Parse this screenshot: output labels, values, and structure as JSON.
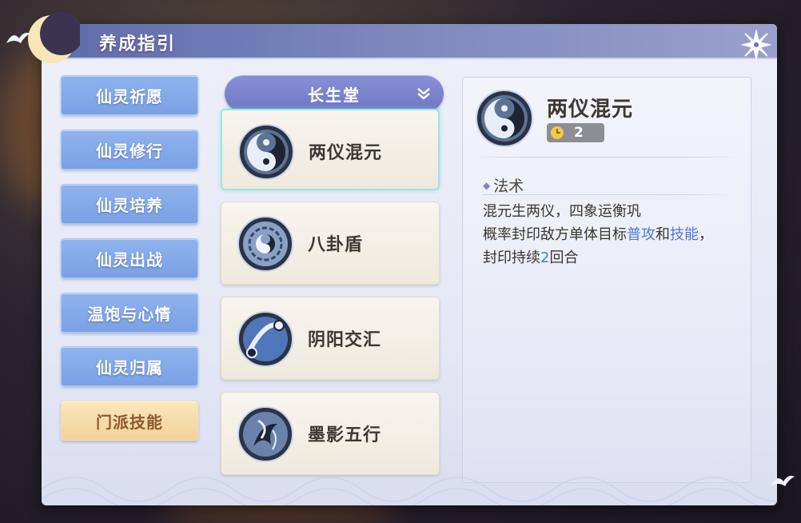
{
  "window": {
    "title": "养成指引"
  },
  "sidebar": {
    "items": [
      {
        "label": "仙灵祈愿"
      },
      {
        "label": "仙灵修行"
      },
      {
        "label": "仙灵培养"
      },
      {
        "label": "仙灵出战"
      },
      {
        "label": "温饱与心情"
      },
      {
        "label": "仙灵归属"
      },
      {
        "label": "门派技能"
      }
    ],
    "active_index": 6
  },
  "category": {
    "selected": "长生堂"
  },
  "skills": [
    {
      "name": "两仪混元"
    },
    {
      "name": "八卦盾"
    },
    {
      "name": "阴阳交汇"
    },
    {
      "name": "墨影五行"
    }
  ],
  "detail": {
    "name": "两仪混元",
    "cost": "2",
    "section_title": "法术",
    "line1": "混元生两仪，四象运衡巩",
    "line2_a": "概率封印敌方单体目标",
    "line2_kw1": "普攻",
    "line2_b": "和",
    "line2_kw2": "技能",
    "line2_c": "，",
    "line3_a": "封印持续",
    "line3_kw": "2",
    "line3_b": "回合"
  },
  "icons": {
    "close": "close-icon",
    "dropdown": "chevron-down-icon",
    "moon": "crescent-moon-icon",
    "cost": "clock-icon"
  },
  "colors": {
    "header": "#6b76b6",
    "nav_button": "#82a8e8",
    "nav_active": "#f6d9a4",
    "keyword": "#4f76d8",
    "selection_outline": "#9ee3e2"
  }
}
